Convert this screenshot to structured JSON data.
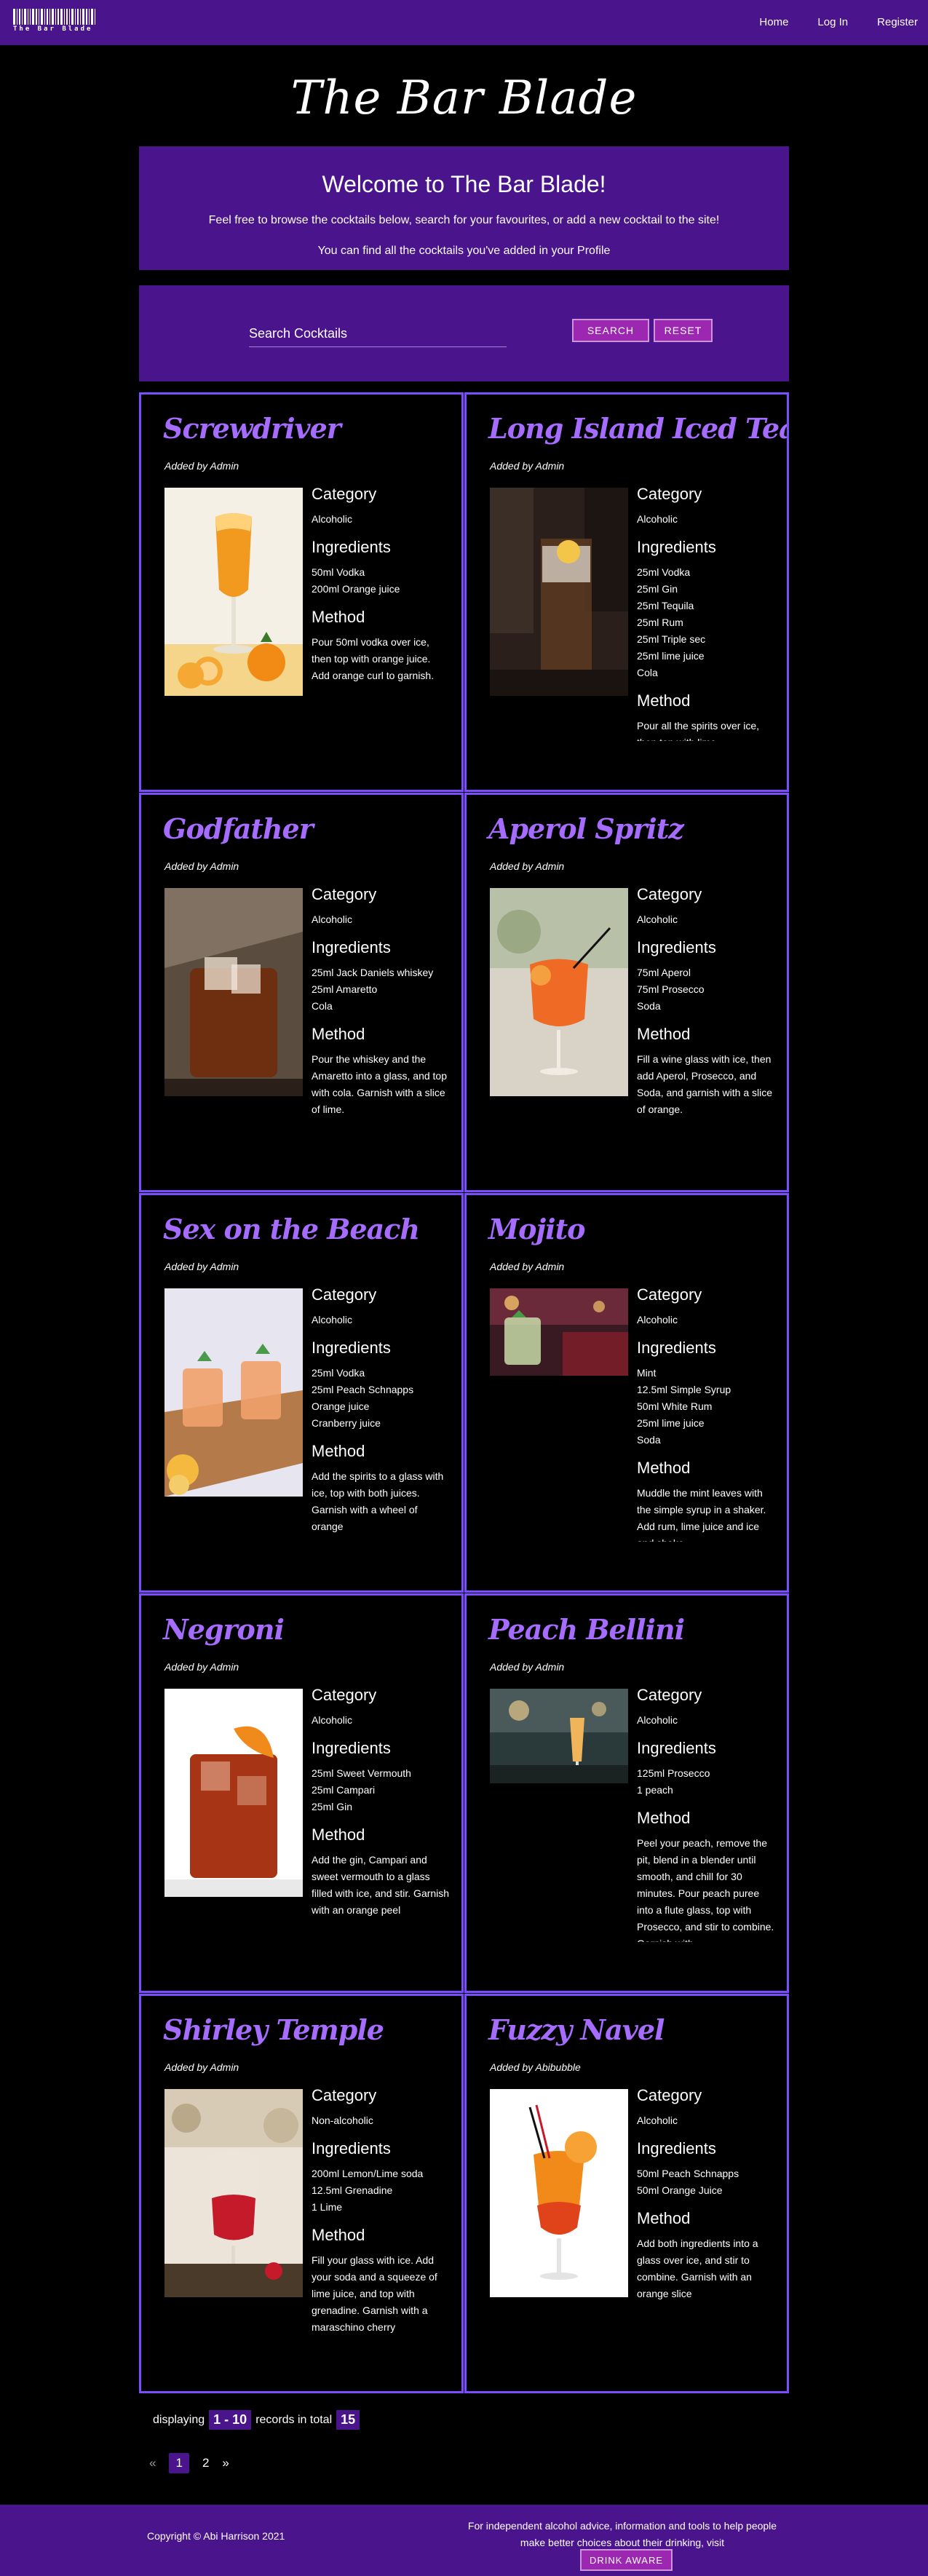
{
  "nav": {
    "logo_text": "The Bar Blade",
    "links": [
      "Home",
      "Log In",
      "Register"
    ]
  },
  "site_title": "The Bar Blade",
  "welcome": {
    "heading": "Welcome to The Bar Blade!",
    "line1": "Feel free to browse the cocktails below, search for your favourites, or add a new cocktail to the site!",
    "line2": "You can find all the cocktails you've added in your Profile"
  },
  "search": {
    "label": "Search Cocktails",
    "search_button": "SEARCH",
    "reset_button": "RESET"
  },
  "labels": {
    "category": "Category",
    "ingredients": "Ingredients",
    "method": "Method"
  },
  "cocktails": [
    {
      "name": "Screwdriver",
      "added_by": "Added by Admin",
      "category": "Alcoholic",
      "ingredients": [
        "50ml Vodka",
        "200ml Orange juice"
      ],
      "method": "Pour 50ml vodka over ice, then top with orange juice. Add orange curl to garnish."
    },
    {
      "name": "Long Island Iced Tea",
      "added_by": "Added by Admin",
      "category": "Alcoholic",
      "ingredients": [
        "25ml Vodka",
        "25ml Gin",
        "25ml Tequila",
        "25ml Rum",
        "25ml Triple sec",
        "25ml lime juice",
        "Cola"
      ],
      "method": "Pour all the spirits over ice, then top with lime"
    },
    {
      "name": "Godfather",
      "added_by": "Added by Admin",
      "category": "Alcoholic",
      "ingredients": [
        "25ml Jack Daniels whiskey",
        "25ml Amaretto",
        "Cola"
      ],
      "method": "Pour the whiskey and the Amaretto into a glass, and top with cola. Garnish with a slice of lime."
    },
    {
      "name": "Aperol Spritz",
      "added_by": "Added by Admin",
      "category": "Alcoholic",
      "ingredients": [
        "75ml Aperol",
        "75ml Prosecco",
        "Soda"
      ],
      "method": "Fill a wine glass with ice, then add Aperol, Prosecco, and Soda, and garnish with a slice of orange."
    },
    {
      "name": "Sex on the Beach",
      "added_by": "Added by Admin",
      "category": "Alcoholic",
      "ingredients": [
        "25ml Vodka",
        "25ml Peach Schnapps",
        "Orange juice",
        "Cranberry juice"
      ],
      "method": "Add the spirits to a glass with ice, top with both juices. Garnish with a wheel of orange"
    },
    {
      "name": "Mojito",
      "added_by": "Added by Admin",
      "category": "Alcoholic",
      "ingredients": [
        "Mint",
        "12.5ml Simple Syrup",
        "50ml White Rum",
        "25ml lime juice",
        "Soda"
      ],
      "method": "Muddle the mint leaves with the simple syrup in a shaker. Add rum, lime juice and ice and shake"
    },
    {
      "name": "Negroni",
      "added_by": "Added by Admin",
      "category": "Alcoholic",
      "ingredients": [
        "25ml Sweet Vermouth",
        "25ml Campari",
        "25ml Gin"
      ],
      "method": "Add the gin, Campari and sweet vermouth to a glass filled with ice, and stir. Garnish with an orange peel"
    },
    {
      "name": "Peach Bellini",
      "added_by": "Added by Admin",
      "category": "Alcoholic",
      "ingredients": [
        "125ml Prosecco",
        "1 peach"
      ],
      "method": "Peel your peach, remove the pit, blend in a blender until smooth, and chill for 30 minutes. Pour peach puree into a flute glass, top with Prosecco, and stir to combine. Garnish with"
    },
    {
      "name": "Shirley Temple",
      "added_by": "Added by Admin",
      "category": "Non-alcoholic",
      "ingredients": [
        "200ml Lemon/Lime soda",
        "12.5ml Grenadine",
        "1 Lime"
      ],
      "method": "Fill your glass with ice. Add your soda and a squeeze of lime juice, and top with grenadine. Garnish with a maraschino cherry"
    },
    {
      "name": "Fuzzy Navel",
      "added_by": "Added by Abibubble",
      "category": "Alcoholic",
      "ingredients": [
        "50ml Peach Schnapps",
        "50ml Orange Juice"
      ],
      "method": "Add both ingredients into a glass over ice, and stir to combine. Garnish with an orange slice"
    }
  ],
  "records": {
    "prefix": "displaying",
    "range": "1 - 10",
    "middle": "records in total",
    "total": "15"
  },
  "pagination": {
    "prev": "«",
    "pages": [
      "1",
      "2"
    ],
    "current": "1",
    "next": "»"
  },
  "footer": {
    "copyright": "Copyright © Abi Harrison 2021",
    "advice": "For independent alcohol advice, information and tools to help people make better choices about their drinking, visit",
    "button": "DRINK AWARE"
  },
  "colors": {
    "brand_purple": "#4a148c",
    "button_purple": "#9c27b0",
    "card_border": "#7c4dff",
    "title_violet": "#a66bff"
  }
}
